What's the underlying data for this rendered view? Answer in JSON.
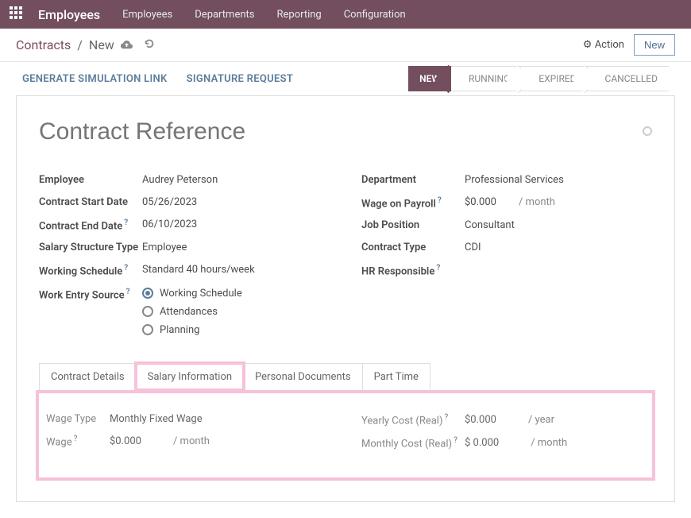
{
  "topbar": {
    "title": "Employees",
    "menu": [
      "Employees",
      "Departments",
      "Reporting",
      "Configuration"
    ]
  },
  "subbar": {
    "breadcrumb_link": "Contracts",
    "breadcrumb_sep": "/",
    "breadcrumb_current": "New",
    "action_label": "Action",
    "new_button": "New"
  },
  "toolbar": {
    "generate_link": "GENERATE SIMULATION LINK",
    "signature_request": "SIGNATURE REQUEST"
  },
  "status": {
    "new": "NEW",
    "running": "RUNNING",
    "expired": "EXPIRED",
    "cancelled": "CANCELLED"
  },
  "form": {
    "title_placeholder": "Contract Reference",
    "left": {
      "employee_label": "Employee",
      "employee_value": "Audrey Peterson",
      "start_label": "Contract Start Date",
      "start_value": "05/26/2023",
      "end_label": "Contract End Date",
      "end_value": "06/10/2023",
      "salary_structure_label": "Salary Structure Type",
      "salary_structure_value": "Employee",
      "schedule_label": "Working Schedule",
      "schedule_value": "Standard 40 hours/week",
      "source_label": "Work Entry Source",
      "source_options": [
        "Working Schedule",
        "Attendances",
        "Planning"
      ]
    },
    "right": {
      "department_label": "Department",
      "department_value": "Professional Services",
      "wage_payroll_label": "Wage on Payroll",
      "wage_payroll_value": "$0.000",
      "wage_payroll_unit": "/ month",
      "job_label": "Job Position",
      "job_value": "Consultant",
      "contract_type_label": "Contract Type",
      "contract_type_value": "CDI",
      "hr_label": "HR Responsible"
    }
  },
  "tabs": {
    "t1": "Contract Details",
    "t2": "Salary Information",
    "t3": "Personal Documents",
    "t4": "Part Time"
  },
  "salary": {
    "wage_type_label": "Wage Type",
    "wage_type_value": "Monthly Fixed Wage",
    "wage_label": "Wage",
    "wage_value": "$0.000",
    "wage_unit": "/ month",
    "yearly_label": "Yearly Cost (Real)",
    "yearly_value": "$0.000",
    "yearly_unit": "/ year",
    "monthly_label": "Monthly Cost (Real)",
    "monthly_value": "$ 0.000",
    "monthly_unit": "/ month"
  },
  "help": "?"
}
